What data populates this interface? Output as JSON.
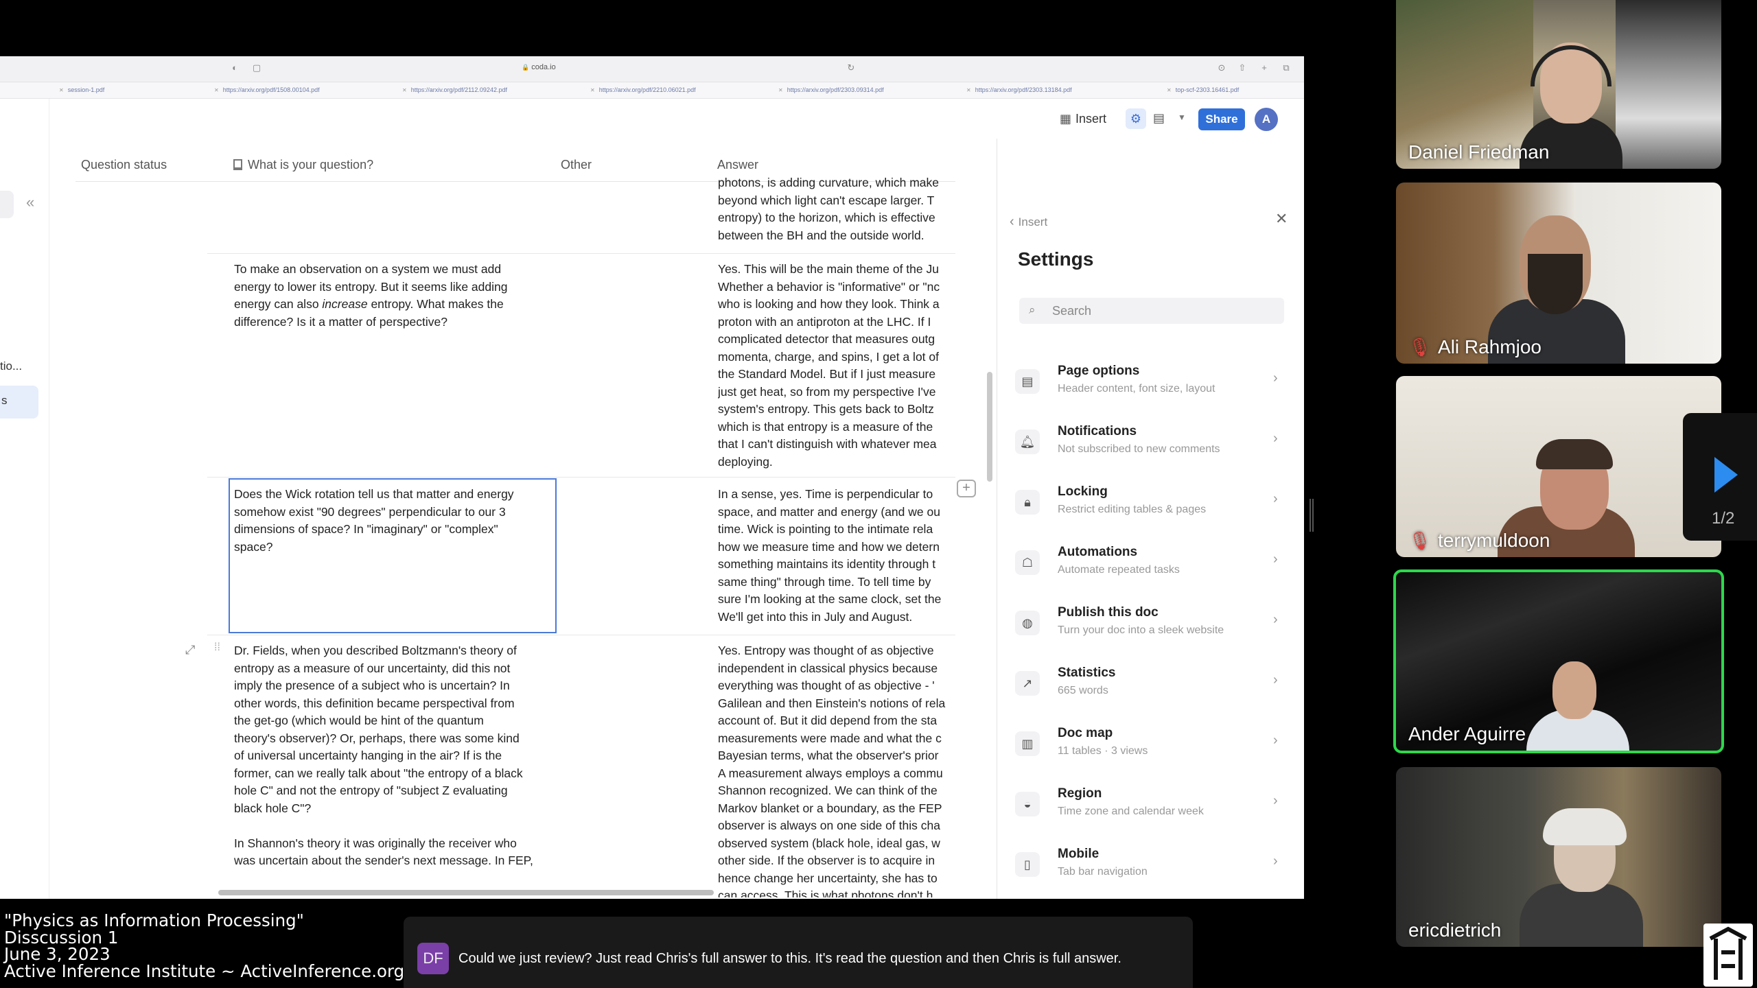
{
  "browser": {
    "url": "coda.io",
    "tabs": [
      "session-1.pdf",
      "https://arxiv.org/pdf/1508.00104.pdf",
      "https://arxiv.org/pdf/2112.09242.pdf",
      "https://arxiv.org/pdf/2210.06021.pdf",
      "https://arxiv.org/pdf/2303.09314.pdf",
      "https://arxiv.org/pdf/2303.13184.pdf",
      "top-scf-2303.16461.pdf"
    ]
  },
  "left_rail": {
    "item1": "tio...",
    "item2": "s"
  },
  "table": {
    "headers": {
      "status": "Question status",
      "question": "What is your question?",
      "other": "Other",
      "answer": "Answer"
    },
    "rows": [
      {
        "question": [],
        "answer": [
          "photons, is adding curvature, which make",
          "beyond which light can't escape larger.  T",
          "entropy) to the horizon, which is effective",
          "between the BH and the outside world."
        ]
      },
      {
        "question": [
          "To make an observation on a system we must add",
          "energy to lower its entropy. But it seems like adding",
          "energy can also increase entropy. What makes the",
          "difference? Is it a matter of perspective?"
        ],
        "answer": [
          "Yes.  This will be the main theme of the Ju",
          "Whether a behavior is \"informative\" or \"nc",
          "who is looking and how they look.  Think a",
          "proton with an antiproton at the LHC.  If I",
          "complicated detector that measures outg",
          "momenta, charge, and spins, I get a lot of",
          "the Standard Model.  But if I just measure",
          "just get heat, so from my perspective I've",
          "system's entropy.  This gets back to Boltz",
          "which is that entropy is a measure of the",
          "that I can't distinguish with whatever mea",
          "deploying."
        ]
      },
      {
        "question": [
          "Does the Wick rotation tell us that matter and energy",
          "somehow exist \"90 degrees\" perpendicular to our 3",
          "dimensions of space? In \"imaginary\" or \"complex\"",
          "space?"
        ],
        "answer": [
          "In a sense, yes.  Time is perpendicular to",
          "space, and matter and energy (and we ou",
          "time.  Wick is pointing to the intimate rela",
          "how we measure time and how we detern",
          "something maintains its identity through t",
          "same thing\" through time.  To tell time by",
          "sure I'm looking at the same clock, set the",
          "We'll get into this in July and August."
        ]
      },
      {
        "question": [
          "Dr. Fields, when you described Boltzmann's theory of",
          "entropy as a measure of our uncertainty, did this not",
          "imply the presence of a subject who is uncertain? In",
          "other words, this definition became perspectival from",
          "the get-go (which would be hint of the quantum",
          "theory's observer)?  Or, perhaps, there was some kind",
          "of universal uncertainty hanging in the air? If is the",
          "former, can we really talk about \"the entropy of a black",
          "hole C\" and not the entropy of \"subject Z evaluating",
          "black hole C\"?",
          "",
          "In Shannon's theory it was originally the receiver who",
          "was uncertain about the sender's next message. In FEP,"
        ],
        "answer": [
          "Yes.  Entropy was thought of as objective",
          "independent in classical physics because",
          "everything was thought of as objective - '",
          "Galilean and then Einstein's notions of rela",
          "account of.  But it did depend from the sta",
          "measurements were made and what the c",
          "Bayesian terms, what the observer's prior",
          "A measurement always employs a commu",
          "Shannon recognized.  We can think of the",
          "Markov blanket or a boundary, as the FEP",
          "observer is always on one side of this cha",
          "observed system (black hole, ideal gas, w",
          "other side.  If the observer is to acquire in",
          "hence change her uncertainty, she has to",
          "can access.  This is what photons don't h"
        ]
      }
    ]
  },
  "toolbar": {
    "insert": "Insert",
    "share": "Share",
    "avatar": "A"
  },
  "settings": {
    "back": "Insert",
    "title": "Settings",
    "search_placeholder": "Search",
    "items": [
      {
        "label": "Page options",
        "sub": "Header content, font size, layout",
        "icon": "page-icon"
      },
      {
        "label": "Notifications",
        "sub": "Not subscribed to new comments",
        "icon": "bell-icon"
      },
      {
        "label": "Locking",
        "sub": "Restrict editing tables & pages",
        "icon": "lock-icon"
      },
      {
        "label": "Automations",
        "sub": "Automate repeated tasks",
        "icon": "robot-icon"
      },
      {
        "label": "Publish this doc",
        "sub": "Turn your doc into a sleek website",
        "icon": "globe-icon"
      },
      {
        "label": "Statistics",
        "sub": "665 words",
        "icon": "chart-icon"
      },
      {
        "label": "Doc map",
        "sub": "11 tables · 3 views",
        "icon": "map-icon"
      },
      {
        "label": "Region",
        "sub": "Time zone and calendar week",
        "icon": "region-icon"
      },
      {
        "label": "Mobile",
        "sub": "Tab bar navigation",
        "icon": "mobile-icon"
      }
    ]
  },
  "participants": [
    {
      "name": "Daniel Friedman",
      "muted": false
    },
    {
      "name": "Ali Rahmjoo",
      "muted": true
    },
    {
      "name": "terrymuldoon",
      "muted": true
    },
    {
      "name": "Ander Aguirre",
      "muted": false,
      "active_speaker": true
    },
    {
      "name": "ericdietrich",
      "muted": false
    }
  ],
  "gallery_page": "1/2",
  "caption": [
    "\"Physics as Information Processing\"",
    "Disscussion 1",
    "June 3, 2023",
    "Active Inference Institute ~ ActiveInference.org"
  ],
  "chat": {
    "initials": "DF",
    "message": "Could we just review? Just read Chris's full answer to this. It's read the question and then Chris is full answer."
  },
  "colors": {
    "accent": "#2f6fd9",
    "active_speaker": "#2dd84c",
    "muted_mic": "#e0413e"
  }
}
